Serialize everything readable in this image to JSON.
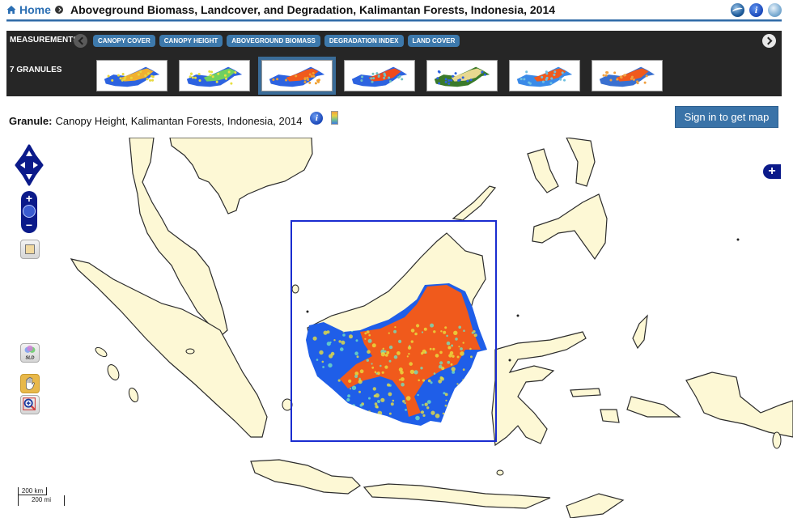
{
  "header": {
    "home_label": "Home",
    "title": "Aboveground Biomass, Landcover, and Degradation, Kalimantan Forests, Indonesia, 2014",
    "icons": [
      "google-earth-icon",
      "info-icon",
      "globe-icon"
    ]
  },
  "measurements": {
    "label": "MEASUREMENTS",
    "items": [
      "CANOPY COVER",
      "CANOPY HEIGHT",
      "ABOVEGROUND BIOMASS",
      "DEGRADATION INDEX",
      "LAND COVER"
    ]
  },
  "granules": {
    "label": "7 GRANULES",
    "count": 7,
    "selected_index": 2,
    "thumbnails": [
      {
        "palette": [
          "#2d63e0",
          "#f0b030",
          "#e8d840"
        ]
      },
      {
        "palette": [
          "#2d63e0",
          "#70d060",
          "#e8e040"
        ]
      },
      {
        "palette": [
          "#2d63e0",
          "#f05a1c",
          "#f0a030"
        ]
      },
      {
        "palette": [
          "#2d63e0",
          "#f04a1c",
          "#70c0c0"
        ]
      },
      {
        "palette": [
          "#3a7a2a",
          "#e8d890",
          "#2d63e0"
        ]
      },
      {
        "palette": [
          "#3a8ae8",
          "#f05a1c",
          "#70c0e0"
        ]
      },
      {
        "palette": [
          "#3a70d0",
          "#f05a1c",
          "#f0a040"
        ]
      }
    ]
  },
  "granule_info": {
    "label": "Granule:",
    "value": "Canopy Height, Kalimantan Forests, Indonesia, 2014"
  },
  "signin_label": "Sign in to get map",
  "map": {
    "land_color": "#fdf8d5",
    "bbox_color": "#1a2cd0",
    "raster_colors": [
      "#1f5ee8",
      "#f05a1c",
      "#e8e040",
      "#70e0c0"
    ],
    "scale_km": "200 km",
    "scale_mi": "200 mi",
    "sld_label": "SLD"
  }
}
